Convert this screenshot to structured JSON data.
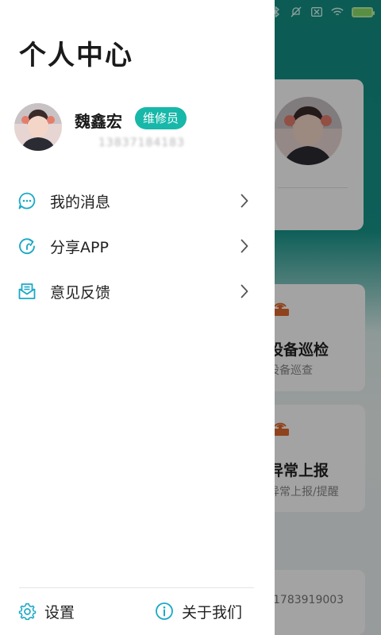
{
  "colors": {
    "accent": "#17b8a9",
    "icon_teal": "#1aa9c5",
    "bg_teal": "#138f84",
    "tile_orange": "#e06a2c",
    "drawer_bg": "#ffffff"
  },
  "drawer": {
    "title": "个人中心",
    "user": {
      "name": "魏鑫宏",
      "role": "维修员",
      "phone_masked": "13837184183"
    },
    "menu": [
      {
        "icon": "message-icon",
        "label": "我的消息"
      },
      {
        "icon": "share-icon",
        "label": "分享APP"
      },
      {
        "icon": "feedback-icon",
        "label": "意见反馈"
      }
    ],
    "footer": {
      "settings": {
        "icon": "gear-icon",
        "label": "设置"
      },
      "about": {
        "icon": "info-icon",
        "label": "关于我们"
      }
    }
  },
  "background": {
    "tiles": [
      {
        "icon": "router-icon",
        "title": "设备巡检",
        "subtitle": "设备巡查"
      },
      {
        "icon": "router-icon",
        "title": "异常上报",
        "subtitle": "异常上报/提醒"
      }
    ],
    "phone_fragment": "1783919003"
  }
}
